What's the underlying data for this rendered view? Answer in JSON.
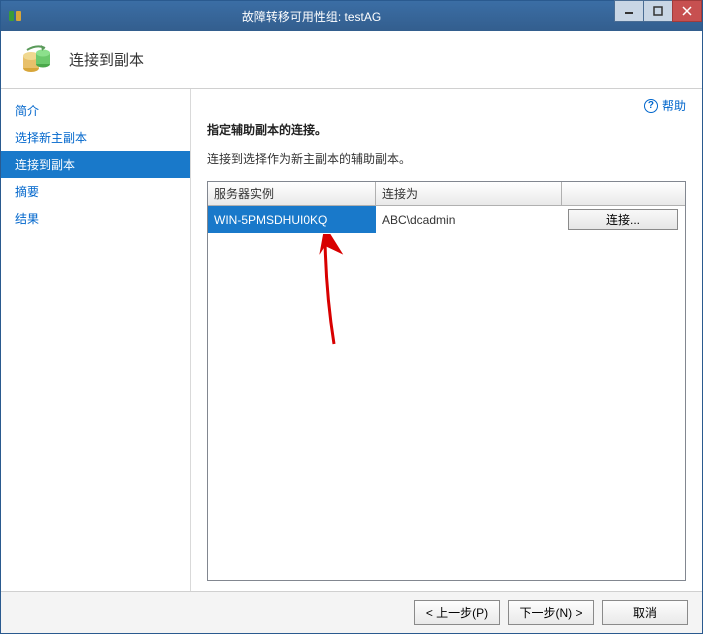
{
  "window": {
    "title": "故障转移可用性组: testAG"
  },
  "header": {
    "title": "连接到副本"
  },
  "sidebar": {
    "items": [
      {
        "label": "简介"
      },
      {
        "label": "选择新主副本"
      },
      {
        "label": "连接到副本"
      },
      {
        "label": "摘要"
      },
      {
        "label": "结果"
      }
    ],
    "activeIndex": 2
  },
  "help": {
    "label": "帮助"
  },
  "content": {
    "heading": "指定辅助副本的连接。",
    "subtext": "连接到选择作为新主副本的辅助副本。"
  },
  "grid": {
    "headers": {
      "col1": "服务器实例",
      "col2": "连接为",
      "col3": ""
    },
    "rows": [
      {
        "instance": "WIN-5PMSDHUI0KQ",
        "connect_as": "ABC\\dcadmin",
        "button_label": "连接..."
      }
    ]
  },
  "footer": {
    "back": "< 上一步(P)",
    "next": "下一步(N) >",
    "cancel": "取消"
  }
}
